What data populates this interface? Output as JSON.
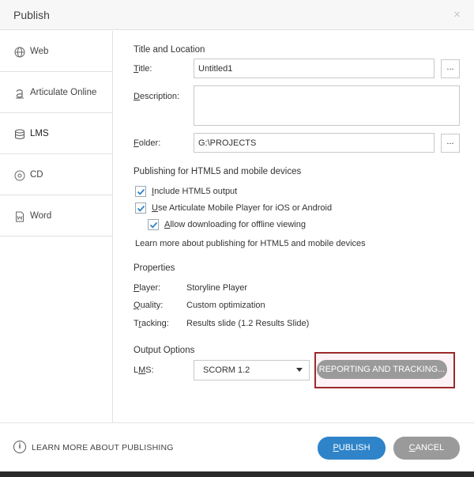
{
  "window": {
    "title": "Publish",
    "close_glyph": "×"
  },
  "sidebar": {
    "items": [
      {
        "label": "Web",
        "icon": "globe-icon"
      },
      {
        "label": "Articulate Online",
        "icon": "articulate-icon"
      },
      {
        "label": "LMS",
        "icon": "database-icon",
        "selected": true
      },
      {
        "label": "CD",
        "icon": "disc-icon"
      },
      {
        "label": "Word",
        "icon": "word-doc-icon"
      }
    ]
  },
  "title_location": {
    "heading": "Title and Location",
    "title_label_ul": "T",
    "title_label_rest": "itle:",
    "title_value": "Untitled1",
    "description_label_ul": "D",
    "description_label_rest": "escription:",
    "description_value": "",
    "folder_label_ul": "F",
    "folder_label_rest": "older:",
    "folder_value": "G:\\PROJECTS",
    "browse_label": "..."
  },
  "html5": {
    "heading": "Publishing for HTML5 and mobile devices",
    "include_label_ul": "I",
    "include_label_rest": "nclude HTML5 output",
    "include_checked": true,
    "mobile_label_ul": "U",
    "mobile_label_rest": "se Articulate Mobile Player for iOS or Android",
    "mobile_checked": true,
    "offline_label_ul": "A",
    "offline_label_rest": "llow downloading for offline viewing",
    "offline_checked": true,
    "learn_more": "Learn more about publishing for HTML5 and mobile devices"
  },
  "properties": {
    "heading": "Properties",
    "player_key_ul": "P",
    "player_key_rest": "layer:",
    "player_value": "Storyline Player",
    "quality_key_ul": "Q",
    "quality_key_rest": "uality:",
    "quality_value": "Custom optimization",
    "tracking_key_pre": "T",
    "tracking_key_ul": "r",
    "tracking_key_rest": "acking:",
    "tracking_value": "Results slide (1.2 Results Slide)"
  },
  "output": {
    "heading": "Output Options",
    "lms_label_pre": "L",
    "lms_label_ul": "M",
    "lms_label_rest": "S:",
    "lms_value": "SCORM 1.2",
    "reporting_button": "REPORTING AND TRACKING..."
  },
  "footer": {
    "info_glyph": "i",
    "learn_more": "LEARN MORE ABOUT PUBLISHING",
    "publish_ul": "P",
    "publish_rest": "UBLISH",
    "cancel_ul": "C",
    "cancel_rest": "ANCEL"
  },
  "colors": {
    "publish": "#2f84c9",
    "cancel": "#9a9a9a",
    "highlight_border": "#9b2a2a",
    "checkbox_mark": "#2f84c9"
  }
}
